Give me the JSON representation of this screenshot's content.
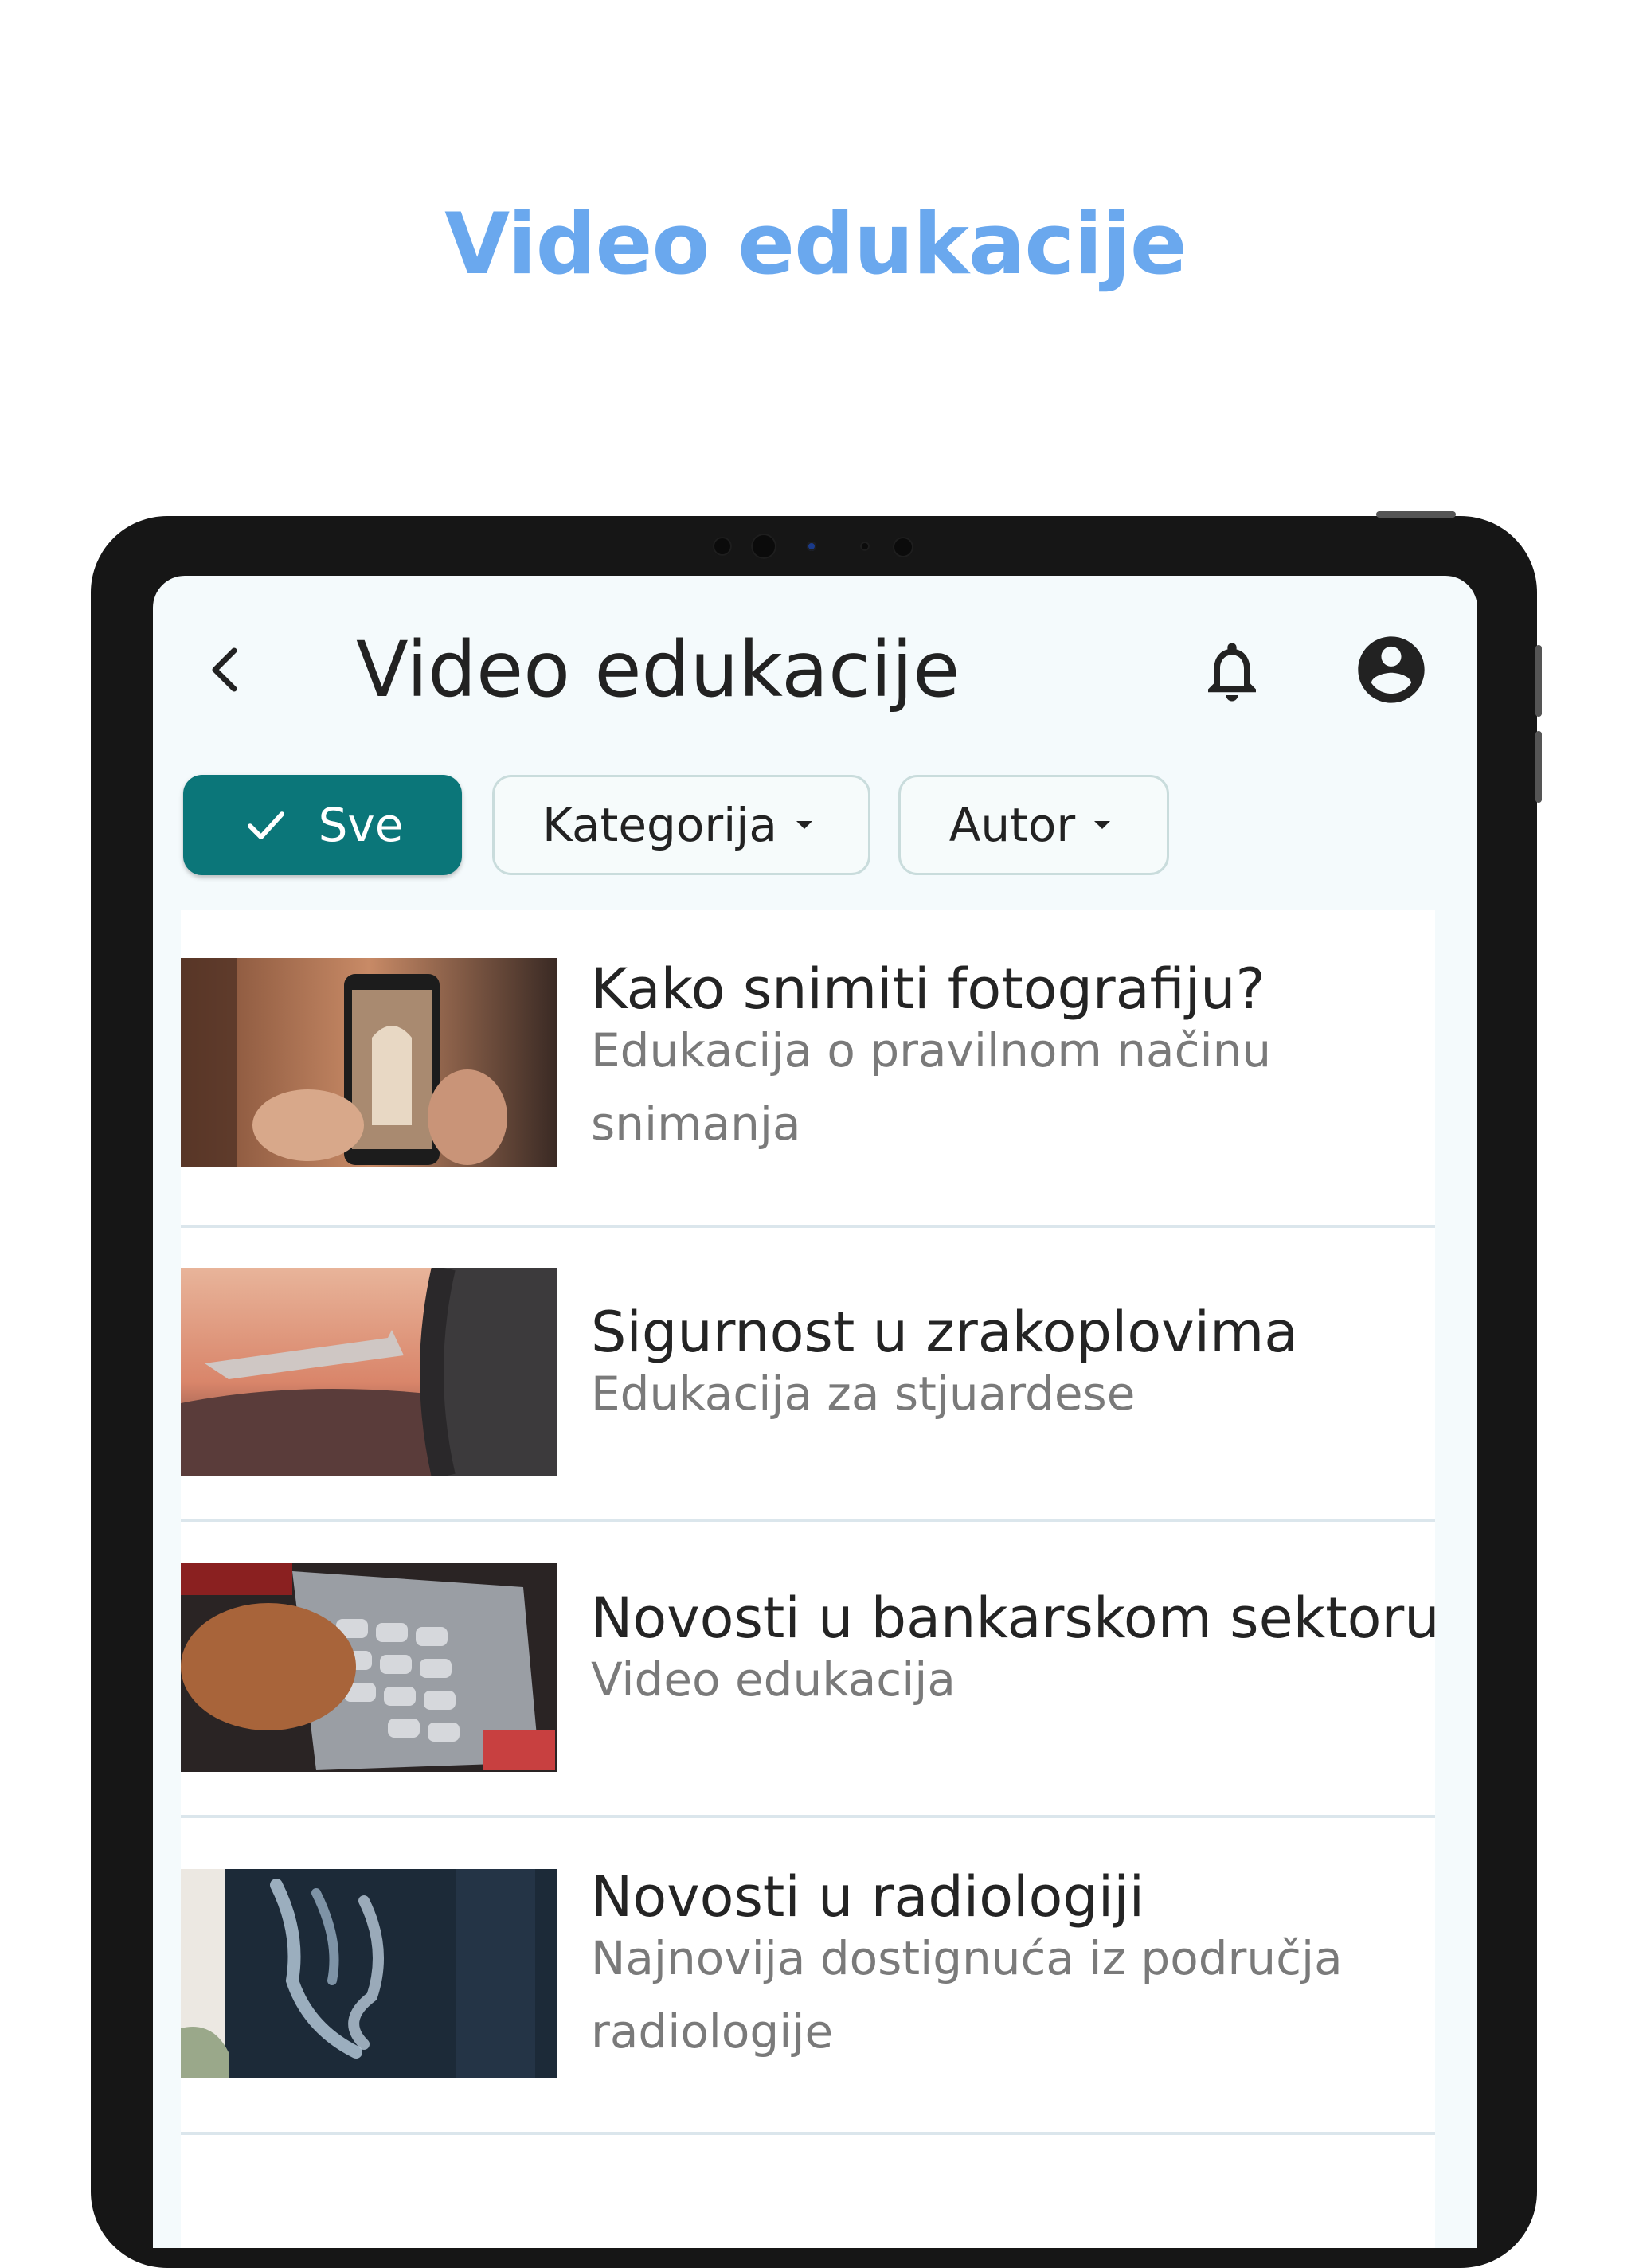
{
  "promo": {
    "title": "Video edukacije"
  },
  "appbar": {
    "title": "Video edukacije"
  },
  "filters": {
    "all_label": "Sve",
    "category_label": "Kategorija",
    "author_label": "Autor"
  },
  "colors": {
    "accent": "#0b7679",
    "promo_title": "#6aa8ee"
  },
  "icons": [
    "back-arrow-icon",
    "bell-icon",
    "account-circle-icon",
    "check-icon",
    "dropdown-arrow-icon"
  ],
  "videos": [
    {
      "title": "Kako snimiti fotografiju?",
      "subtitle": "Edukacija o pravilnom načinu snimanja"
    },
    {
      "title": "Sigurnost u zrakoplovima",
      "subtitle": "Edukacija za stjuardese"
    },
    {
      "title": "Novosti u bankarskom sektoru",
      "subtitle": "Video edukacija"
    },
    {
      "title": "Novosti u radiologiji",
      "subtitle": "Najnovija dostignuća iz područja radiologije"
    }
  ]
}
